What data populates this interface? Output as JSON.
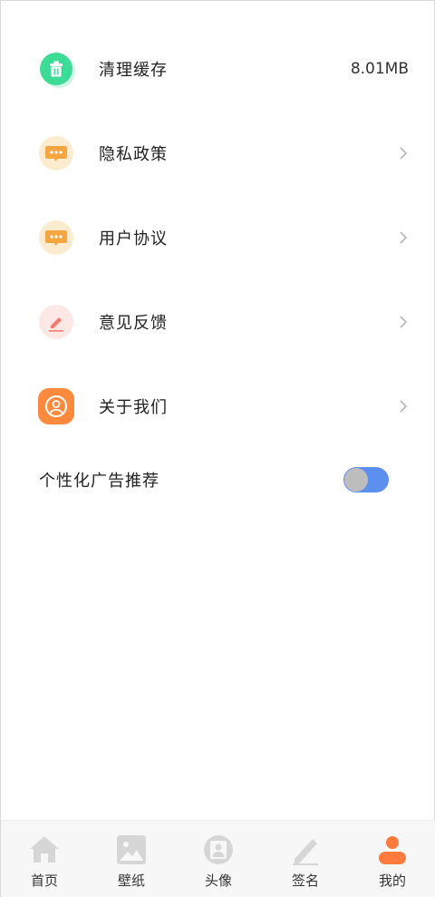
{
  "menu": {
    "items": [
      {
        "label": "清理缓存",
        "value": "8.01MB",
        "icon": "trash-icon",
        "color": "#3ddc97"
      },
      {
        "label": "隐私政策",
        "icon": "message-dots-icon",
        "color": "#f5a640"
      },
      {
        "label": "用户协议",
        "icon": "message-dots-icon",
        "color": "#f5a640"
      },
      {
        "label": "意见反馈",
        "icon": "pen-icon",
        "color": "#f07b6e"
      },
      {
        "label": "关于我们",
        "icon": "user-circle-icon",
        "color": "#ff8a3d"
      }
    ]
  },
  "ad_toggle": {
    "label": "个性化广告推荐",
    "on": true,
    "track_color": "#5b8ff0"
  },
  "tabbar": {
    "tabs": [
      {
        "label": "首页",
        "icon": "home-icon"
      },
      {
        "label": "壁纸",
        "icon": "image-icon"
      },
      {
        "label": "头像",
        "icon": "avatar-frame-icon"
      },
      {
        "label": "签名",
        "icon": "pencil-icon"
      },
      {
        "label": "我的",
        "icon": "person-icon",
        "active": true
      }
    ],
    "active_color": "#ff7a3d",
    "inactive_color": "#d6d6d6"
  }
}
